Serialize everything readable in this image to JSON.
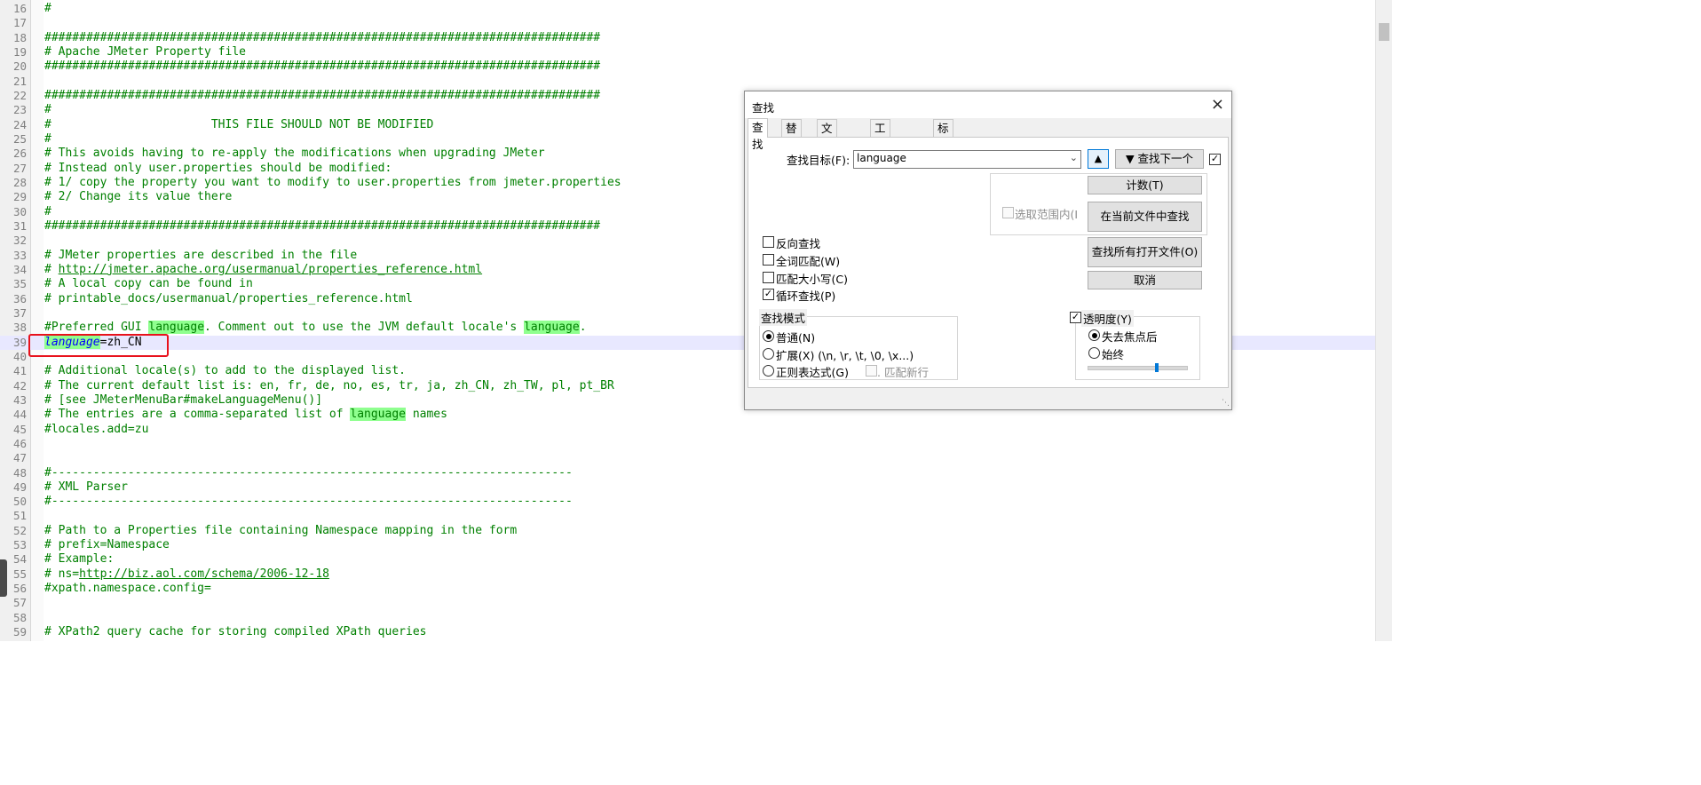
{
  "editor": {
    "lines": [
      {
        "n": "16",
        "text": "#"
      },
      {
        "n": "17",
        "text": ""
      },
      {
        "n": "18",
        "text": "################################################################################"
      },
      {
        "n": "19",
        "text": "# Apache JMeter Property file"
      },
      {
        "n": "20",
        "text": "################################################################################"
      },
      {
        "n": "21",
        "text": ""
      },
      {
        "n": "22",
        "text": "################################################################################"
      },
      {
        "n": "23",
        "text": "#"
      },
      {
        "n": "24",
        "text": "#                       THIS FILE SHOULD NOT BE MODIFIED"
      },
      {
        "n": "25",
        "text": "#"
      },
      {
        "n": "26",
        "text": "# This avoids having to re-apply the modifications when upgrading JMeter"
      },
      {
        "n": "27",
        "text": "# Instead only user.properties should be modified:"
      },
      {
        "n": "28",
        "text": "# 1/ copy the property you want to modify to user.properties from jmeter.properties"
      },
      {
        "n": "29",
        "text": "# 2/ Change its value there"
      },
      {
        "n": "30",
        "text": "#"
      },
      {
        "n": "31",
        "text": "################################################################################"
      },
      {
        "n": "32",
        "text": ""
      },
      {
        "n": "33",
        "text": "# JMeter properties are described in the file"
      },
      {
        "n": "34",
        "text": "# http://jmeter.apache.org/usermanual/properties_reference.html"
      },
      {
        "n": "35",
        "text": "# A local copy can be found in"
      },
      {
        "n": "36",
        "text": "# printable_docs/usermanual/properties_reference.html"
      },
      {
        "n": "37",
        "text": ""
      },
      {
        "n": "38",
        "text": "#Preferred GUI language. Comment out to use the JVM default locale's language."
      },
      {
        "n": "39",
        "text": "language=zh_CN"
      },
      {
        "n": "40",
        "text": ""
      },
      {
        "n": "41",
        "text": "# Additional locale(s) to add to the displayed list."
      },
      {
        "n": "42",
        "text": "# The current default list is: en, fr, de, no, es, tr, ja, zh_CN, zh_TW, pl, pt_BR"
      },
      {
        "n": "43",
        "text": "# [see JMeterMenuBar#makeLanguageMenu()]"
      },
      {
        "n": "44",
        "text": "# The entries are a comma-separated list of language names"
      },
      {
        "n": "45",
        "text": "#locales.add=zu"
      },
      {
        "n": "46",
        "text": ""
      },
      {
        "n": "47",
        "text": ""
      },
      {
        "n": "48",
        "text": "#---------------------------------------------------------------------------"
      },
      {
        "n": "49",
        "text": "# XML Parser"
      },
      {
        "n": "50",
        "text": "#---------------------------------------------------------------------------"
      },
      {
        "n": "51",
        "text": ""
      },
      {
        "n": "52",
        "text": "# Path to a Properties file containing Namespace mapping in the form"
      },
      {
        "n": "53",
        "text": "# prefix=Namespace"
      },
      {
        "n": "54",
        "text": "# Example:"
      },
      {
        "n": "55",
        "text": "# ns=http://biz.aol.com/schema/2006-12-18"
      },
      {
        "n": "56",
        "text": "#xpath.namespace.config="
      },
      {
        "n": "57",
        "text": ""
      },
      {
        "n": "58",
        "text": ""
      },
      {
        "n": "59",
        "text": "# XPath2 query cache for storing compiled XPath queries"
      }
    ],
    "search_term": "language",
    "current_line": "39"
  },
  "dialog": {
    "title": "查找",
    "close_icon": "×",
    "tabs": [
      "查找",
      "替换",
      "文件查找",
      "工程中查找",
      "标记"
    ],
    "find_label": "查找目标(F):",
    "find_value": "language",
    "up_button": "▲",
    "find_next_button": "▼ 查找下一个",
    "count_button": "计数(T)",
    "in_selection_label": "选取范围内(I",
    "find_in_current_file_button": "在当前文件中查找",
    "find_all_open_files_button": "查找所有打开文件(O)",
    "cancel_button": "取消",
    "options": [
      {
        "label": "反向查找",
        "checked": false
      },
      {
        "label": "全词匹配(W)",
        "checked": false
      },
      {
        "label": "匹配大小写(C)",
        "checked": false
      },
      {
        "label": "循环查找(P)",
        "checked": true
      }
    ],
    "search_mode": {
      "title": "查找模式",
      "modes": [
        {
          "label": "普通(N)",
          "selected": true
        },
        {
          "label": "扩展(X) (\\n, \\r, \\t, \\0, \\x...)",
          "selected": false
        },
        {
          "label": "正则表达式(G)",
          "selected": false
        }
      ],
      "dot_newline_label": ". 匹配新行"
    },
    "transparency": {
      "title": "透明度(Y)",
      "checked": true,
      "options": [
        {
          "label": "失去焦点后",
          "selected": true
        },
        {
          "label": "始终",
          "selected": false
        }
      ],
      "level": 0.7
    }
  }
}
